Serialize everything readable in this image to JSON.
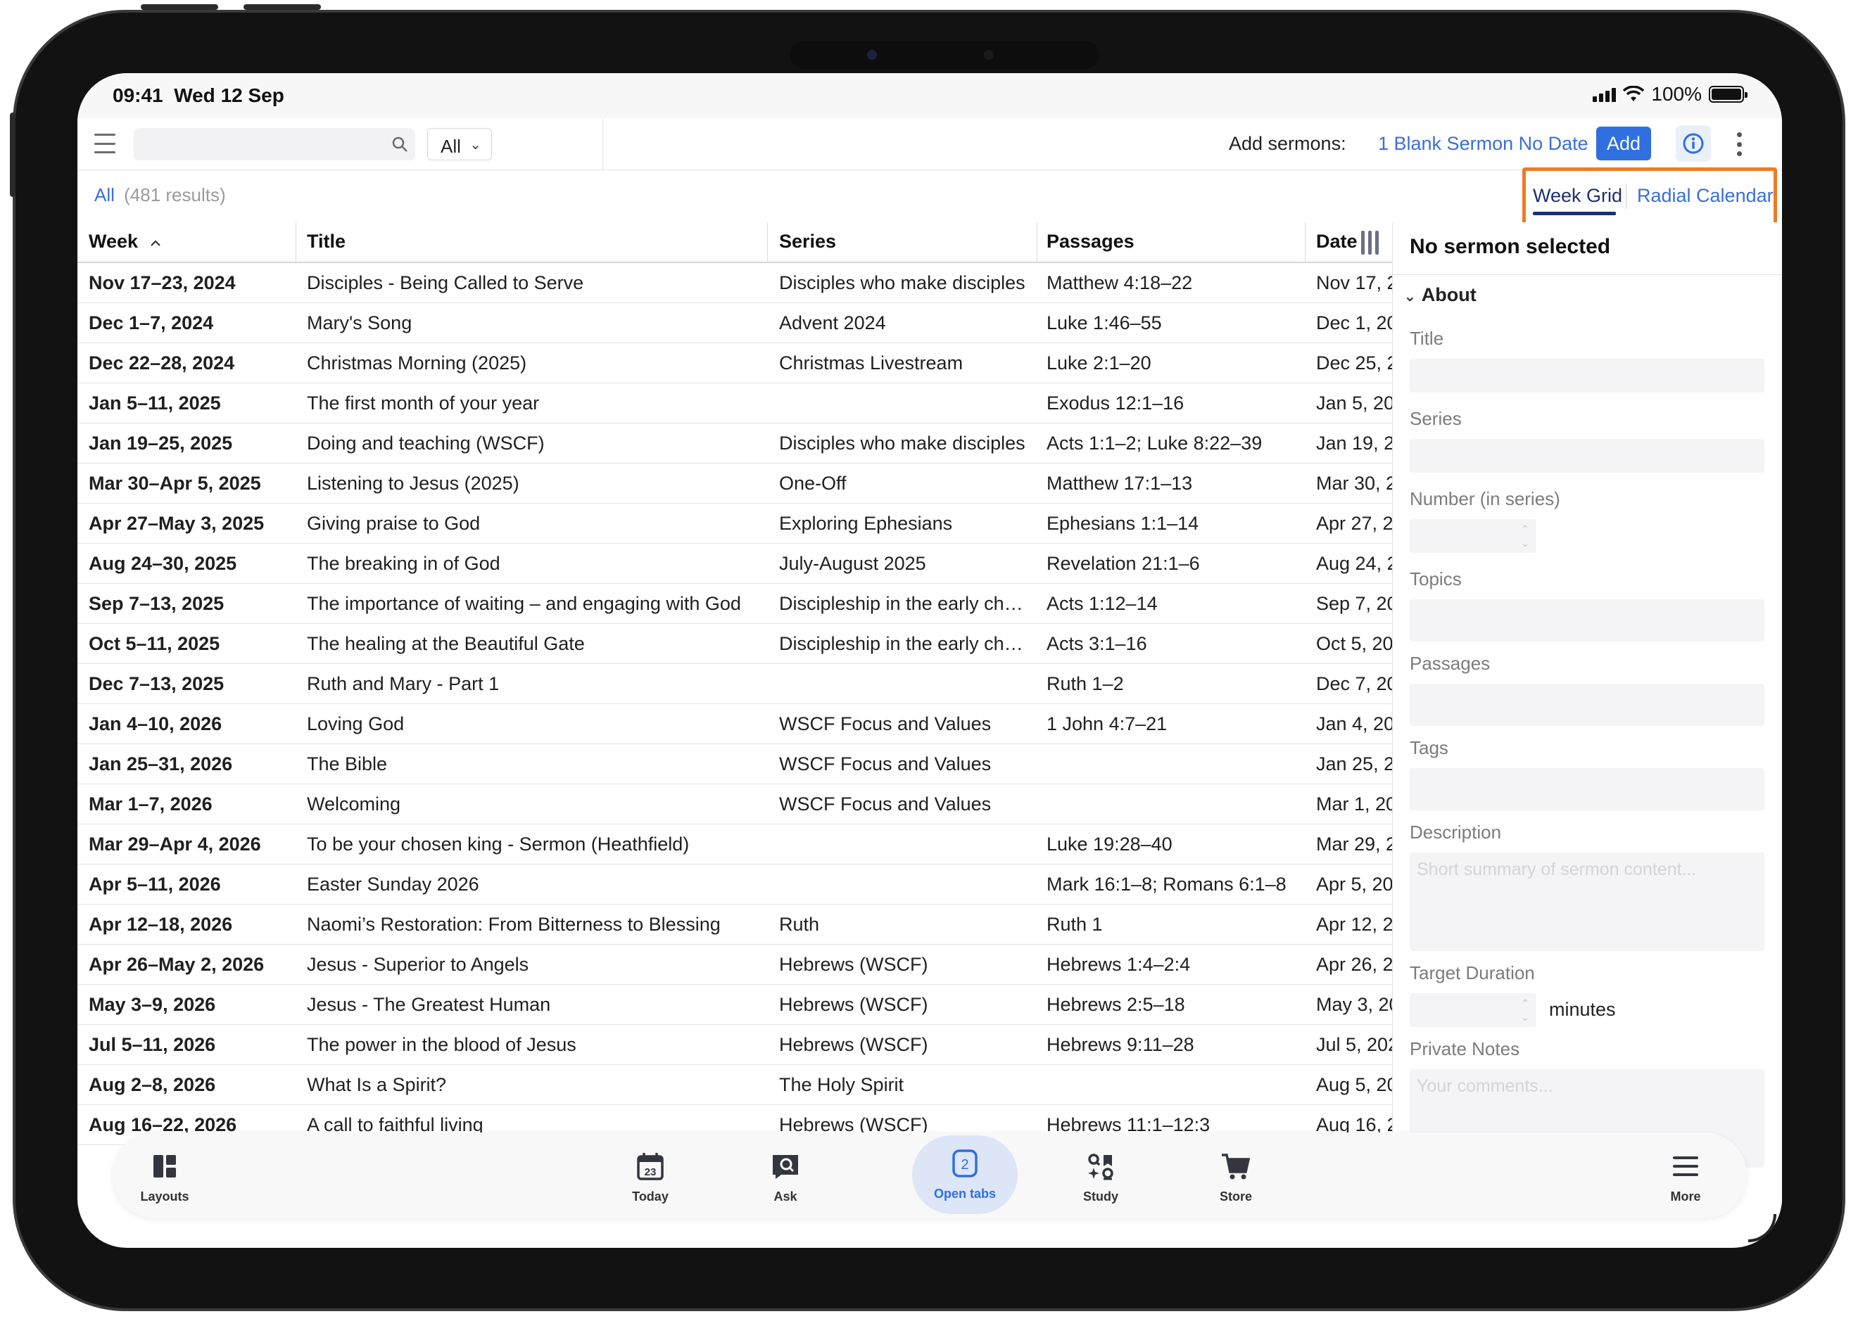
{
  "status_bar": {
    "time": "09:41",
    "date": "Wed 12 Sep",
    "battery": "100%"
  },
  "toolbar": {
    "search_placeholder": "",
    "filter_value": "All",
    "add_sermons_label": "Add sermons:",
    "blank_sermon_link": "1 Blank Sermon No Date",
    "add_button": "Add"
  },
  "results": {
    "filter_label": "All",
    "count_text": "(481 results)"
  },
  "view_tabs": {
    "active": "Week Grid",
    "other": "Radial Calendar"
  },
  "table": {
    "headers": {
      "week": "Week",
      "title": "Title",
      "series": "Series",
      "passages": "Passages",
      "date": "Date"
    },
    "sort": {
      "column": "Week",
      "direction": "ascending"
    },
    "rows": [
      {
        "week": "Nov 17–23, 2024",
        "title": "Disciples - Being Called to Serve",
        "series": "Disciples who make disciples",
        "passages": "Matthew 4:18–22",
        "date": "Nov 17, 2"
      },
      {
        "week": "Dec 1–7, 2024",
        "title": "Mary's Song",
        "series": "Advent 2024",
        "passages": "Luke 1:46–55",
        "date": "Dec 1, 20"
      },
      {
        "week": "Dec 22–28, 2024",
        "title": "Christmas Morning (2025)",
        "series": "Christmas Livestream",
        "passages": "Luke 2:1–20",
        "date": "Dec 25, 2"
      },
      {
        "week": "Jan 5–11, 2025",
        "title": "The first month of your year",
        "series": "",
        "passages": "Exodus 12:1–16",
        "date": "Jan 5, 202"
      },
      {
        "week": "Jan 19–25, 2025",
        "title": "Doing and teaching (WSCF)",
        "series": "Disciples who make disciples",
        "passages": "Acts 1:1–2; Luke 8:22–39",
        "date": "Jan 19, 2"
      },
      {
        "week": "Mar 30–Apr 5, 2025",
        "title": "Listening to Jesus (2025)",
        "series": "One-Off",
        "passages": "Matthew 17:1–13",
        "date": "Mar 30, 2"
      },
      {
        "week": "Apr 27–May 3, 2025",
        "title": "Giving praise to God",
        "series": "Exploring Ephesians",
        "passages": "Ephesians 1:1–14",
        "date": "Apr 27, 2"
      },
      {
        "week": "Aug 24–30, 2025",
        "title": "The breaking in of God",
        "series": "July-August 2025",
        "passages": "Revelation 21:1–6",
        "date": "Aug 24, 2"
      },
      {
        "week": "Sep 7–13, 2025",
        "title": "The importance of waiting – and engaging with God",
        "series": "Discipleship in the early ch…",
        "passages": "Acts 1:12–14",
        "date": "Sep 7, 20"
      },
      {
        "week": "Oct 5–11, 2025",
        "title": "The healing at the Beautiful Gate",
        "series": "Discipleship in the early ch…",
        "passages": "Acts 3:1–16",
        "date": "Oct 5, 202"
      },
      {
        "week": "Dec 7–13, 2025",
        "title": "Ruth and Mary - Part 1",
        "series": "",
        "passages": "Ruth 1–2",
        "date": "Dec 7, 20"
      },
      {
        "week": "Jan 4–10, 2026",
        "title": "Loving God",
        "series": "WSCF Focus and Values",
        "passages": "1 John 4:7–21",
        "date": "Jan 4, 20"
      },
      {
        "week": "Jan 25–31, 2026",
        "title": "The Bible",
        "series": "WSCF Focus and Values",
        "passages": "",
        "date": "Jan 25, 2"
      },
      {
        "week": "Mar 1–7, 2026",
        "title": "Welcoming",
        "series": "WSCF Focus and Values",
        "passages": "",
        "date": "Mar 1, 20"
      },
      {
        "week": "Mar 29–Apr 4, 2026",
        "title": "To be your chosen king - Sermon (Heathfield)",
        "series": "",
        "passages": "Luke 19:28–40",
        "date": "Mar 29, 2"
      },
      {
        "week": "Apr 5–11, 2026",
        "title": "Easter Sunday 2026",
        "series": "",
        "passages": "Mark 16:1–8; Romans 6:1–8",
        "date": "Apr 5, 20"
      },
      {
        "week": "Apr 12–18, 2026",
        "title": "Naomi’s Restoration: From Bitterness to Blessing",
        "series": "Ruth",
        "passages": "Ruth 1",
        "date": "Apr 12, 2"
      },
      {
        "week": "Apr 26–May 2, 2026",
        "title": "Jesus - Superior to Angels",
        "series": "Hebrews (WSCF)",
        "passages": "Hebrews 1:4–2:4",
        "date": "Apr 26, 2"
      },
      {
        "week": "May 3–9, 2026",
        "title": "Jesus - The Greatest Human",
        "series": "Hebrews (WSCF)",
        "passages": "Hebrews 2:5–18",
        "date": "May 3, 20"
      },
      {
        "week": "Jul 5–11, 2026",
        "title": "The power in the blood of Jesus",
        "series": "Hebrews (WSCF)",
        "passages": "Hebrews 9:11–28",
        "date": "Jul 5, 202"
      },
      {
        "week": "Aug 2–8, 2026",
        "title": "What Is a Spirit?",
        "series": "The Holy Spirit",
        "passages": "",
        "date": "Aug 5, 20"
      },
      {
        "week": "Aug 16–22, 2026",
        "title": "A call to faithful living",
        "series": "Hebrews (WSCF)",
        "passages": "Hebrews 11:1–12:3",
        "date": "Aug 16, 2"
      }
    ]
  },
  "side_panel": {
    "heading": "No sermon selected",
    "section": "About",
    "labels": {
      "title": "Title",
      "series": "Series",
      "number": "Number (in series)",
      "topics": "Topics",
      "passages": "Passages",
      "tags": "Tags",
      "description": "Description",
      "target_duration": "Target Duration",
      "private_notes": "Private Notes"
    },
    "description_placeholder": "Short summary of sermon content...",
    "notes_placeholder": "Your comments...",
    "minutes_unit": "minutes"
  },
  "bottom_nav": {
    "items": [
      {
        "label": "Layouts",
        "icon": "layouts-icon"
      },
      {
        "label": "Today",
        "icon": "calendar-icon",
        "badge": "23"
      },
      {
        "label": "Ask",
        "icon": "ask-icon"
      },
      {
        "label": "Open tabs",
        "icon": "tabs-icon",
        "badge": "2"
      },
      {
        "label": "Study",
        "icon": "study-icon"
      },
      {
        "label": "Store",
        "icon": "cart-icon"
      },
      {
        "label": "More",
        "icon": "menu-icon"
      }
    ],
    "active": "Open tabs"
  },
  "colors": {
    "accent": "#2f6fe0",
    "highlight": "#f07a22",
    "active_tab": "#1c2f6e"
  }
}
